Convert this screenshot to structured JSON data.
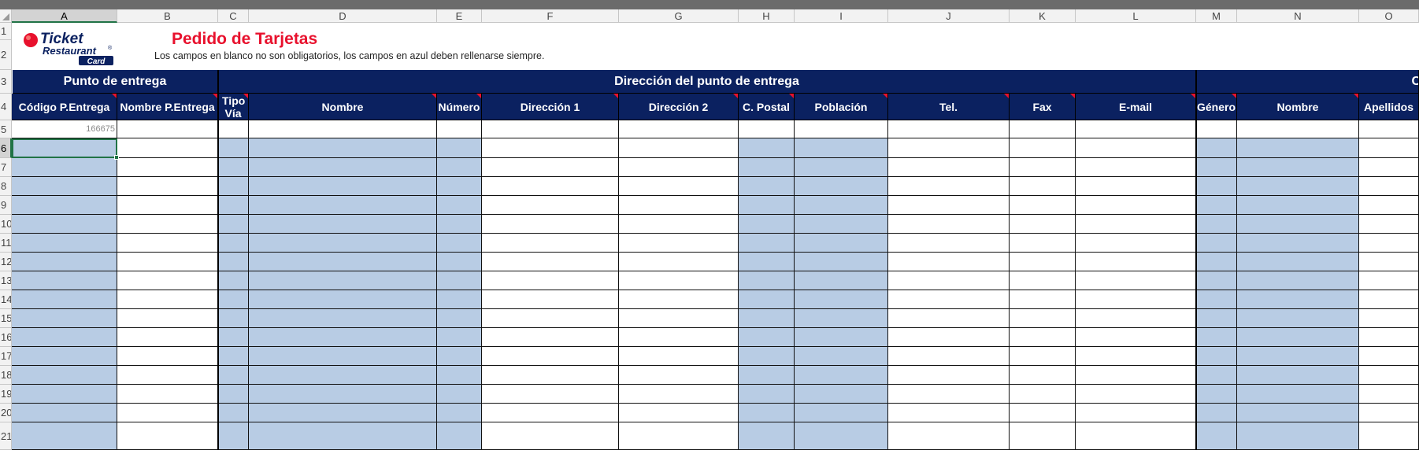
{
  "columns": [
    "A",
    "B",
    "C",
    "D",
    "E",
    "F",
    "G",
    "H",
    "I",
    "J",
    "K",
    "L",
    "M",
    "N",
    "O"
  ],
  "rows": [
    "1",
    "2",
    "3",
    "4",
    "5",
    "6",
    "7",
    "8",
    "9",
    "10",
    "11",
    "12",
    "13",
    "14",
    "15",
    "16",
    "17",
    "18",
    "19",
    "20",
    "21"
  ],
  "selected_cell": {
    "column": "A",
    "row": "6"
  },
  "logo": {
    "line1": "Ticket",
    "line2": "Restaurant",
    "line3": "Card",
    "mark": "®"
  },
  "title": "Pedido de Tarjetas",
  "subtitle": "Los campos en blanco no son obligatorios, los campos en azul deben rellenarse siempre.",
  "groups": {
    "punto": "Punto de entrega",
    "direccion": "Dirección del punto de entrega",
    "cut": "C"
  },
  "headers": {
    "A": "Código P.Entrega",
    "B": "Nombre P.Entrega",
    "C": "Tipo Vía",
    "D": "Nombre",
    "E": "Número",
    "F": "Dirección 1",
    "G": "Dirección 2",
    "H": "C. Postal",
    "I": "Población",
    "J": "Tel.",
    "K": "Fax",
    "L": "E-mail",
    "M": "Género",
    "N": "Nombre",
    "O": "Apellidos"
  },
  "row5": {
    "A": "166675"
  },
  "colors": {
    "navy": "#0b2160",
    "input_blue": "#b8cce4",
    "title_red": "#e8112d",
    "excel_green": "#217346"
  }
}
